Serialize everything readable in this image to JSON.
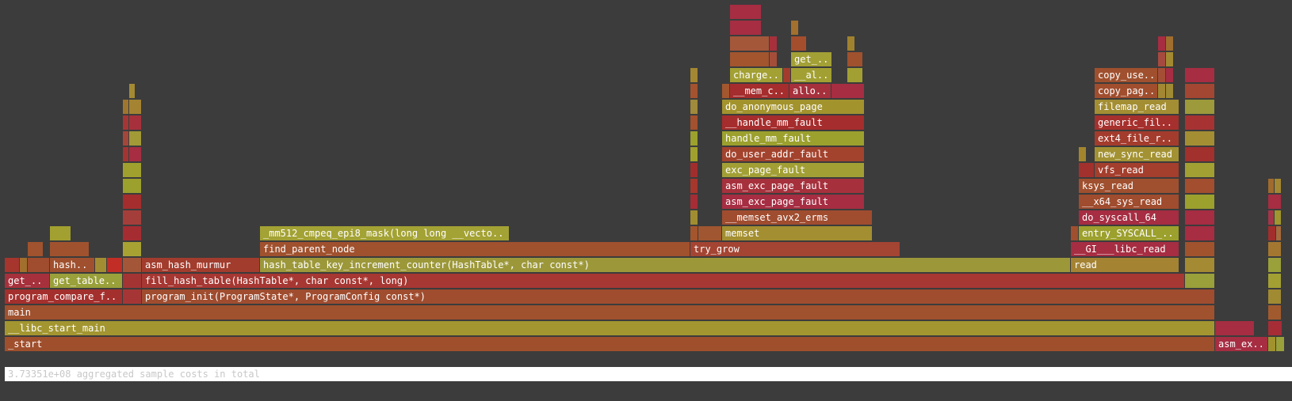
{
  "footer": {
    "summary": "3.73351e+08 aggregated sample costs in total"
  },
  "chart_data": {
    "type": "flamegraph",
    "total": "3.73351e+08",
    "frames": [
      {
        "d": 0,
        "s": 0,
        "w": 1527,
        "n": "_start",
        "c": "#a04f2d"
      },
      {
        "d": 0,
        "s": 1527,
        "w": 67,
        "n": "asm_exc_page_fault",
        "c": "#a62d42"
      },
      {
        "d": 0,
        "s": 1594,
        "w": 10,
        "n": "",
        "c": "#a1922d"
      },
      {
        "d": 0,
        "s": 1604,
        "w": 11,
        "n": "",
        "c": "#9aa03a"
      },
      {
        "d": 1,
        "s": 0,
        "w": 1527,
        "n": "__libc_start_main",
        "c": "#a39630"
      },
      {
        "d": 1,
        "s": 1527,
        "w": 50,
        "n": "",
        "c": "#a62d42"
      },
      {
        "d": 1,
        "s": 1594,
        "w": 18,
        "n": "",
        "c": "#a62d36"
      },
      {
        "d": 2,
        "s": 0,
        "w": 1527,
        "n": "main",
        "c": "#a0512e"
      },
      {
        "d": 2,
        "s": 1594,
        "w": 17,
        "n": "",
        "c": "#a15a2e"
      },
      {
        "d": 3,
        "s": 0,
        "w": 149,
        "n": "program_compare_files",
        "c": "#a4302d"
      },
      {
        "d": 3,
        "s": 149,
        "w": 24,
        "n": "",
        "c": "#a63636"
      },
      {
        "d": 3,
        "s": 173,
        "w": 1354,
        "n": "program_init(ProgramState*, ProgramConfig const*)",
        "c": "#a04c2f"
      },
      {
        "d": 3,
        "s": 1594,
        "w": 17,
        "n": "",
        "c": "#a08a32"
      },
      {
        "d": 4,
        "s": 0,
        "w": 57,
        "n": "get_cost",
        "c": "#a6313c"
      },
      {
        "d": 4,
        "s": 57,
        "w": 92,
        "n": "get_table_dist",
        "c": "#9aa03a"
      },
      {
        "d": 4,
        "s": 149,
        "w": 24,
        "n": "",
        "c": "#a43434"
      },
      {
        "d": 4,
        "s": 173,
        "w": 1316,
        "n": "fill_hash_table(HashTable*, char const*, long)",
        "c": "#a63732"
      },
      {
        "d": 4,
        "s": 1489,
        "w": 38,
        "n": "",
        "c": "#9aa03a"
      },
      {
        "d": 4,
        "s": 1594,
        "w": 17,
        "n": "",
        "c": "#a3a033"
      },
      {
        "d": 5,
        "s": 0,
        "w": 19,
        "n": "",
        "c": "#a5352d"
      },
      {
        "d": 5,
        "s": 19,
        "w": 10,
        "n": "",
        "c": "#a36f2d"
      },
      {
        "d": 5,
        "s": 29,
        "w": 28,
        "n": "",
        "c": "#a04c2e"
      },
      {
        "d": 5,
        "s": 57,
        "w": 57,
        "n": "hash_table",
        "c": "#a0502e"
      },
      {
        "d": 5,
        "s": 114,
        "w": 15,
        "n": "",
        "c": "#a38d33"
      },
      {
        "d": 5,
        "s": 129,
        "w": 20,
        "n": "",
        "c": "#c22e26"
      },
      {
        "d": 5,
        "s": 149,
        "w": 24,
        "n": "",
        "c": "#a45738"
      },
      {
        "d": 5,
        "s": 173,
        "w": 149,
        "n": "asm_hash_murmur",
        "c": "#a23c2d"
      },
      {
        "d": 5,
        "s": 322,
        "w": 1023,
        "n": "hash_table_key_increment_counter(HashTable*, char const*)",
        "c": "#9c983a"
      },
      {
        "d": 5,
        "s": 1345,
        "w": 137,
        "n": "read",
        "c": "#a48333"
      },
      {
        "d": 5,
        "s": 1489,
        "w": 38,
        "n": "",
        "c": "#a38a33"
      },
      {
        "d": 5,
        "s": 1594,
        "w": 17,
        "n": "",
        "c": "#9aa03a"
      },
      {
        "d": 6,
        "s": 29,
        "w": 20,
        "n": "",
        "c": "#a0532e"
      },
      {
        "d": 6,
        "s": 57,
        "w": 50,
        "n": "",
        "c": "#a0522e"
      },
      {
        "d": 6,
        "s": 149,
        "w": 24,
        "n": "",
        "c": "#a8a233"
      },
      {
        "d": 6,
        "s": 322,
        "w": 543,
        "n": "find_parent_node",
        "c": "#a0512e"
      },
      {
        "d": 6,
        "s": 865,
        "w": 265,
        "n": "try_grow",
        "c": "#a44432"
      },
      {
        "d": 6,
        "s": 1345,
        "w": 137,
        "n": "__GI___libc_read",
        "c": "#a62d42"
      },
      {
        "d": 6,
        "s": 1489,
        "w": 38,
        "n": "",
        "c": "#a1532e"
      },
      {
        "d": 6,
        "s": 1594,
        "w": 17,
        "n": "",
        "c": "#a47730"
      },
      {
        "d": 7,
        "s": 57,
        "w": 27,
        "n": "",
        "c": "#a2a030"
      },
      {
        "d": 7,
        "s": 149,
        "w": 24,
        "n": "",
        "c": "#a52d32"
      },
      {
        "d": 7,
        "s": 322,
        "w": 315,
        "n": "_mm512_cmpeq_epi8_mask(long long __vector(8), long long __vector(8))",
        "c": "#a3a234"
      },
      {
        "d": 7,
        "s": 865,
        "w": 10,
        "n": "",
        "c": "#a3552e"
      },
      {
        "d": 7,
        "s": 875,
        "w": 30,
        "n": "",
        "c": "#a05630"
      },
      {
        "d": 7,
        "s": 905,
        "w": 190,
        "n": "memset",
        "c": "#a38f31"
      },
      {
        "d": 7,
        "s": 1345,
        "w": 10,
        "n": "",
        "c": "#a0502e"
      },
      {
        "d": 7,
        "s": 1355,
        "w": 127,
        "n": "entry_SYSCALL_64_after_hwframe",
        "c": "#9ca02d"
      },
      {
        "d": 7,
        "s": 1489,
        "w": 38,
        "n": "",
        "c": "#a62d42"
      },
      {
        "d": 7,
        "s": 1594,
        "w": 10,
        "n": "",
        "c": "#a22d2d"
      },
      {
        "d": 7,
        "s": 1604,
        "w": 7,
        "n": "",
        "c": "#a66a3c"
      },
      {
        "d": 8,
        "s": 149,
        "w": 24,
        "n": "",
        "c": "#a43e3b"
      },
      {
        "d": 8,
        "s": 865,
        "w": 10,
        "n": "",
        "c": "#a18d31"
      },
      {
        "d": 8,
        "s": 905,
        "w": 190,
        "n": "__memset_avx2_erms",
        "c": "#a04c2f"
      },
      {
        "d": 8,
        "s": 1355,
        "w": 127,
        "n": "do_syscall_64",
        "c": "#a62d42"
      },
      {
        "d": 8,
        "s": 1489,
        "w": 38,
        "n": "",
        "c": "#a62d42"
      },
      {
        "d": 8,
        "s": 1594,
        "w": 8,
        "n": "",
        "c": "#a3354a"
      },
      {
        "d": 8,
        "s": 1602,
        "w": 9,
        "n": "",
        "c": "#a0952e"
      },
      {
        "d": 9,
        "s": 149,
        "w": 24,
        "n": "",
        "c": "#a52d2d"
      },
      {
        "d": 9,
        "s": 865,
        "w": 10,
        "n": "",
        "c": "#a62d36"
      },
      {
        "d": 9,
        "s": 905,
        "w": 180,
        "n": "asm_exc_page_fault",
        "c": "#a62d42"
      },
      {
        "d": 9,
        "s": 1355,
        "w": 127,
        "n": "__x64_sys_read",
        "c": "#a04c2e"
      },
      {
        "d": 9,
        "s": 1489,
        "w": 38,
        "n": "",
        "c": "#9ca02d"
      },
      {
        "d": 9,
        "s": 1594,
        "w": 17,
        "n": "",
        "c": "#a62d42"
      },
      {
        "d": 10,
        "s": 149,
        "w": 24,
        "n": "",
        "c": "#9ca02d"
      },
      {
        "d": 10,
        "s": 865,
        "w": 10,
        "n": "",
        "c": "#a5372d"
      },
      {
        "d": 10,
        "s": 905,
        "w": 180,
        "n": "asm_exc_page_fault",
        "c": "#a6313c"
      },
      {
        "d": 10,
        "s": 1355,
        "w": 127,
        "n": "ksys_read",
        "c": "#a0502e"
      },
      {
        "d": 10,
        "s": 1489,
        "w": 38,
        "n": "",
        "c": "#a34e2e"
      },
      {
        "d": 10,
        "s": 1594,
        "w": 8,
        "n": "",
        "c": "#a06b2e"
      },
      {
        "d": 10,
        "s": 1602,
        "w": 9,
        "n": "",
        "c": "#a38732"
      },
      {
        "d": 11,
        "s": 149,
        "w": 24,
        "n": "",
        "c": "#a0a02e"
      },
      {
        "d": 11,
        "s": 865,
        "w": 10,
        "n": "",
        "c": "#a22d2d"
      },
      {
        "d": 11,
        "s": 905,
        "w": 180,
        "n": "exc_page_fault",
        "c": "#a2a035"
      },
      {
        "d": 11,
        "s": 1355,
        "w": 20,
        "n": "",
        "c": "#a2302d"
      },
      {
        "d": 11,
        "s": 1375,
        "w": 107,
        "n": "vfs_read",
        "c": "#a43e2d"
      },
      {
        "d": 11,
        "s": 1489,
        "w": 38,
        "n": "",
        "c": "#a2a032"
      },
      {
        "d": 12,
        "s": 149,
        "w": 8,
        "n": "",
        "c": "#a43432"
      },
      {
        "d": 12,
        "s": 157,
        "w": 16,
        "n": "",
        "c": "#a62d42"
      },
      {
        "d": 12,
        "s": 865,
        "w": 10,
        "n": "",
        "c": "#a1a02e"
      },
      {
        "d": 12,
        "s": 905,
        "w": 180,
        "n": "do_user_addr_fault",
        "c": "#a3432d"
      },
      {
        "d": 12,
        "s": 1355,
        "w": 10,
        "n": "",
        "c": "#a3852e"
      },
      {
        "d": 12,
        "s": 1375,
        "w": 107,
        "n": "new_sync_read",
        "c": "#a39233"
      },
      {
        "d": 12,
        "s": 1489,
        "w": 38,
        "n": "",
        "c": "#a2302d"
      },
      {
        "d": 13,
        "s": 149,
        "w": 8,
        "n": "",
        "c": "#a5463a"
      },
      {
        "d": 13,
        "s": 157,
        "w": 16,
        "n": "",
        "c": "#a19a36"
      },
      {
        "d": 13,
        "s": 865,
        "w": 10,
        "n": "",
        "c": "#9ca02d"
      },
      {
        "d": 13,
        "s": 905,
        "w": 180,
        "n": "handle_mm_fault",
        "c": "#9ca02d"
      },
      {
        "d": 13,
        "s": 1375,
        "w": 107,
        "n": "ext4_file_read_iter",
        "c": "#a43c2d"
      },
      {
        "d": 13,
        "s": 1489,
        "w": 38,
        "n": "",
        "c": "#a38e33"
      },
      {
        "d": 14,
        "s": 149,
        "w": 8,
        "n": "",
        "c": "#a63636"
      },
      {
        "d": 14,
        "s": 157,
        "w": 16,
        "n": "",
        "c": "#a6313c"
      },
      {
        "d": 14,
        "s": 865,
        "w": 10,
        "n": "",
        "c": "#a3512e"
      },
      {
        "d": 14,
        "s": 905,
        "w": 180,
        "n": "__handle_mm_fault",
        "c": "#a62d2d"
      },
      {
        "d": 14,
        "s": 1375,
        "w": 107,
        "n": "generic_file_read_iter",
        "c": "#a6302d"
      },
      {
        "d": 14,
        "s": 1489,
        "w": 38,
        "n": "",
        "c": "#a63232"
      },
      {
        "d": 15,
        "s": 149,
        "w": 8,
        "n": "",
        "c": "#a0762e"
      },
      {
        "d": 15,
        "s": 157,
        "w": 16,
        "n": "",
        "c": "#a48432"
      },
      {
        "d": 15,
        "s": 865,
        "w": 10,
        "n": "",
        "c": "#a08a3b"
      },
      {
        "d": 15,
        "s": 905,
        "w": 180,
        "n": "do_anonymous_page",
        "c": "#a3932d"
      },
      {
        "d": 15,
        "s": 1375,
        "w": 107,
        "n": "filemap_read",
        "c": "#a38e33"
      },
      {
        "d": 15,
        "s": 1489,
        "w": 38,
        "n": "",
        "c": "#9c9a3a"
      },
      {
        "d": 16,
        "s": 157,
        "w": 8,
        "n": "",
        "c": "#a38a32"
      },
      {
        "d": 16,
        "s": 865,
        "w": 10,
        "n": "",
        "c": "#a4532e"
      },
      {
        "d": 16,
        "s": 905,
        "w": 10,
        "n": "",
        "c": "#a3572e"
      },
      {
        "d": 16,
        "s": 915,
        "w": 75,
        "n": "__mem_cgroup_charge",
        "c": "#a62d2d"
      },
      {
        "d": 16,
        "s": 990,
        "w": 53,
        "n": "alloc_pages_vma",
        "c": "#a6313c"
      },
      {
        "d": 16,
        "s": 1043,
        "w": 42,
        "n": "",
        "c": "#a62d42"
      },
      {
        "d": 16,
        "s": 1375,
        "w": 80,
        "n": "copy_page_to_iter",
        "c": "#a04e2e"
      },
      {
        "d": 16,
        "s": 1455,
        "w": 10,
        "n": "",
        "c": "#a38732"
      },
      {
        "d": 16,
        "s": 1465,
        "w": 10,
        "n": "",
        "c": "#a08a33"
      },
      {
        "d": 16,
        "s": 1489,
        "w": 38,
        "n": "",
        "c": "#a34732"
      },
      {
        "d": 17,
        "s": 865,
        "w": 10,
        "n": "",
        "c": "#a48733"
      },
      {
        "d": 17,
        "s": 915,
        "w": 67,
        "n": "charge_memcg",
        "c": "#a3a034"
      },
      {
        "d": 17,
        "s": 982,
        "w": 10,
        "n": "",
        "c": "#a33c2d"
      },
      {
        "d": 17,
        "s": 992,
        "w": 52,
        "n": "__alloc_pages",
        "c": "#a2a032"
      },
      {
        "d": 17,
        "s": 1063,
        "w": 20,
        "n": "",
        "c": "#a2a032"
      },
      {
        "d": 17,
        "s": 1375,
        "w": 80,
        "n": "copy_user_enhanced_fast_string",
        "c": "#a0502e"
      },
      {
        "d": 17,
        "s": 1455,
        "w": 10,
        "n": "",
        "c": "#a54e36"
      },
      {
        "d": 17,
        "s": 1465,
        "w": 10,
        "n": "",
        "c": "#a62d42"
      },
      {
        "d": 17,
        "s": 1489,
        "w": 38,
        "n": "",
        "c": "#a62d42"
      },
      {
        "d": 18,
        "s": 915,
        "w": 50,
        "n": "",
        "c": "#a3552e"
      },
      {
        "d": 18,
        "s": 965,
        "w": 10,
        "n": "",
        "c": "#a44e3a"
      },
      {
        "d": 18,
        "s": 992,
        "w": 52,
        "n": "get_page_from_freelist",
        "c": "#a3a036"
      },
      {
        "d": 18,
        "s": 1063,
        "w": 20,
        "n": "",
        "c": "#a0512e"
      },
      {
        "d": 18,
        "s": 1455,
        "w": 10,
        "n": "",
        "c": "#a64a40"
      },
      {
        "d": 18,
        "s": 1465,
        "w": 10,
        "n": "",
        "c": "#a38a32"
      },
      {
        "d": 19,
        "s": 915,
        "w": 50,
        "n": "",
        "c": "#a5573a"
      },
      {
        "d": 19,
        "s": 965,
        "w": 10,
        "n": "",
        "c": "#a6313c"
      },
      {
        "d": 19,
        "s": 992,
        "w": 20,
        "n": "",
        "c": "#a44e2d"
      },
      {
        "d": 19,
        "s": 1063,
        "w": 10,
        "n": "",
        "c": "#a0822e"
      },
      {
        "d": 19,
        "s": 1455,
        "w": 10,
        "n": "",
        "c": "#a62d42"
      },
      {
        "d": 19,
        "s": 1465,
        "w": 10,
        "n": "",
        "c": "#a06e2e"
      },
      {
        "d": 20,
        "s": 915,
        "w": 40,
        "n": "",
        "c": "#a62d42"
      },
      {
        "d": 20,
        "s": 992,
        "w": 10,
        "n": "",
        "c": "#a3702e"
      },
      {
        "d": 21,
        "s": 915,
        "w": 40,
        "n": "",
        "c": "#a62d42"
      }
    ]
  }
}
